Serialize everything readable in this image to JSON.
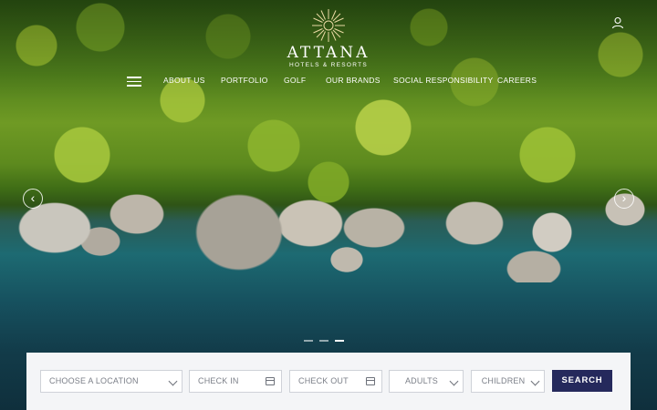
{
  "brand": {
    "name": "ATTANA",
    "tagline": "HOTELS & RESORTS",
    "accent_color": "#25295c"
  },
  "header": {
    "user_icon": "user-icon",
    "menu_icon": "hamburger-menu-icon",
    "nav": [
      "ABOUT US",
      "PORTFOLIO",
      "GOLF",
      "OUR BRANDS",
      "SOCIAL RESPONSIBILITY",
      "CAREERS"
    ]
  },
  "hero": {
    "prev_arrow": "‹",
    "next_arrow": "›",
    "slides_total": 3,
    "active_slide": 3
  },
  "booking": {
    "location": "CHOOSE A LOCATION",
    "check_in": "CHECK IN",
    "check_out": "CHECK OUT",
    "adults": "ADULTS",
    "children": "CHILDREN",
    "search_label": "SEARCH"
  }
}
